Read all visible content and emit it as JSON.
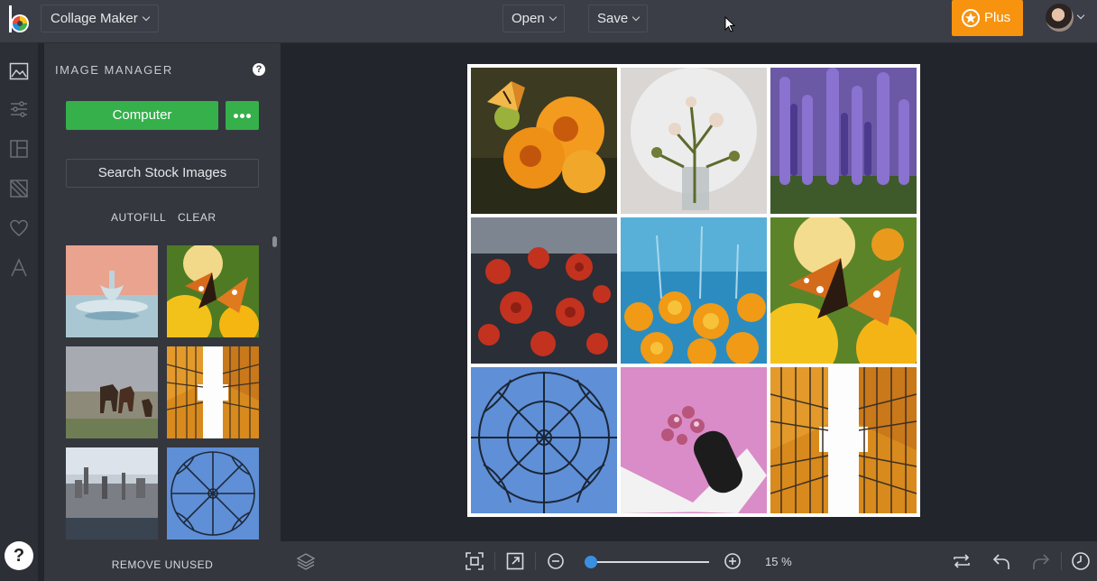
{
  "header": {
    "app_menu_label": "Collage Maker",
    "open_label": "Open",
    "save_label": "Save",
    "plus_label": "Plus"
  },
  "rail": {
    "items": [
      "image-manager",
      "adjust",
      "layout",
      "background",
      "favorites",
      "text"
    ]
  },
  "panel": {
    "title": "IMAGE MANAGER",
    "help_glyph": "?",
    "computer_label": "Computer",
    "stock_label": "Search Stock Images",
    "autofill_label": "AUTOFILL",
    "clear_label": "CLEAR",
    "remove_unused_label": "REMOVE UNUSED",
    "thumbnails": [
      "water-drop",
      "butterfly-flower",
      "horses",
      "skyscrapers",
      "city-skyline",
      "dome-window"
    ]
  },
  "canvas": {
    "cells": [
      "butterfly-orange-flower",
      "white-plant-vase",
      "lavender-field",
      "red-flowers",
      "orange-poppies-blue",
      "butterfly-yellow-flower",
      "blue-dome-window",
      "pink-flowers-vase",
      "skyscrapers-up"
    ]
  },
  "footer": {
    "zoom_label": "15 %",
    "zoom_fraction": 0.15,
    "help_glyph": "?"
  },
  "colors": {
    "accent_green": "#35b04a",
    "accent_orange": "#f7930f",
    "slider_blue": "#3b8fe0"
  }
}
